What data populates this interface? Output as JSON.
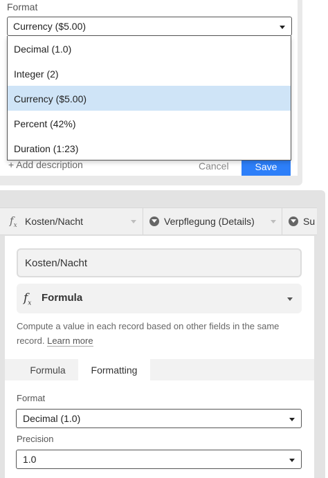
{
  "top_dialog": {
    "format_label": "Format",
    "selected_value": "Currency ($5.00)",
    "options": [
      {
        "label": "Decimal (1.0)",
        "selected": false
      },
      {
        "label": "Integer (2)",
        "selected": false
      },
      {
        "label": "Currency ($5.00)",
        "selected": true
      },
      {
        "label": "Percent (42%)",
        "selected": false
      },
      {
        "label": "Duration (1:23)",
        "selected": false
      }
    ],
    "add_description": "+ Add description",
    "cancel": "Cancel",
    "save": "Save"
  },
  "header_columns": [
    {
      "label": "Kosten/Nacht",
      "icon": "formula-icon"
    },
    {
      "label": "Verpflegung (Details)",
      "icon": "single-select-icon"
    },
    {
      "label": "Su",
      "icon": "single-select-icon"
    }
  ],
  "field_editor": {
    "field_name": "Kosten/Nacht",
    "field_type": "Formula",
    "description": "Compute a value in each record based on other fields in the same record.",
    "learn_more": "Learn more",
    "tabs": [
      {
        "label": "Formula",
        "active": false
      },
      {
        "label": "Formatting",
        "active": true
      }
    ],
    "format_label": "Format",
    "format_value": "Decimal (1.0)",
    "precision_label": "Precision",
    "precision_value": "1.0"
  },
  "colors": {
    "accent": "#2d7ff9",
    "selected_option": "#cfe4f7"
  }
}
